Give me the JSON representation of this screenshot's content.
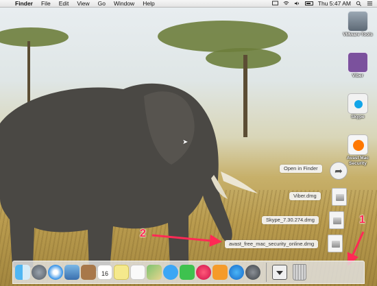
{
  "menubar": {
    "apple_glyph": "",
    "app_name": "Finder",
    "menus": [
      "File",
      "Edit",
      "View",
      "Go",
      "Window",
      "Help"
    ],
    "clock": "Thu 5:47 AM"
  },
  "desktop_icons": [
    {
      "label": "VMware Tools",
      "icon": "vmware-tools-icon"
    },
    {
      "label": "Viber",
      "icon": "viber-icon"
    },
    {
      "label": "Skype",
      "icon": "skype-icon"
    },
    {
      "label": "Avast Mac Security",
      "icon": "avast-icon"
    }
  ],
  "stack_popup": {
    "open_in_finder": "Open in Finder",
    "files": [
      "Viber.dmg",
      "Skype_7.30.274.dmg",
      "avast_free_mac_security_online.dmg"
    ]
  },
  "annotations": {
    "callout_1": "1",
    "callout_2": "2",
    "arrow_color": "#ff2a55"
  },
  "dock": {
    "apps": [
      "finder",
      "launchpad",
      "safari",
      "mail",
      "contacts",
      "calendar",
      "notes",
      "reminders",
      "maps",
      "messages",
      "facetime",
      "itunes",
      "ibooks",
      "app-store",
      "system-preferences"
    ],
    "calendar_day": "16",
    "stack": "downloads-stack",
    "trash": "trash"
  }
}
